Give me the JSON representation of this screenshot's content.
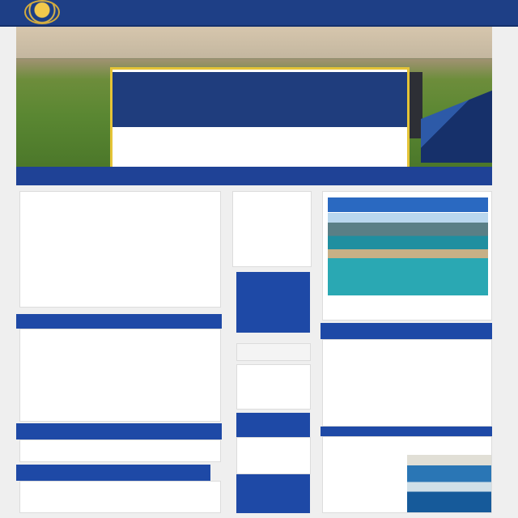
{
  "header": {
    "nav_left": [
      "",
      "",
      "",
      ""
    ],
    "nav_right": [
      "",
      "",
      ""
    ],
    "cta": ""
  },
  "hero": {
    "title": "",
    "body": ""
  },
  "ribbon": {
    "left": "",
    "middle": ""
  },
  "left": {
    "card1": {
      "title": "",
      "body": "",
      "link": ""
    },
    "strip2": "",
    "card2": {
      "title": "",
      "body": "",
      "link": ""
    },
    "strip3": "",
    "card3": {
      "body": ""
    },
    "strip4": "",
    "card4": {
      "title": "",
      "body": ""
    }
  },
  "middle": {
    "m1": {
      "title": "",
      "body": ""
    },
    "mb1": {
      "title": "",
      "body": ""
    },
    "m3": {
      "title": "",
      "body": ""
    },
    "mb2": {
      "title": ""
    },
    "m4": {
      "title": "",
      "body": ""
    },
    "mb3": {
      "title": ""
    }
  },
  "right": {
    "r1": {
      "head": "",
      "caption": ""
    },
    "r2": {
      "title": "",
      "col1": "",
      "col2": ""
    },
    "r3": {
      "title": "",
      "body": "",
      "photo_label": ""
    }
  }
}
